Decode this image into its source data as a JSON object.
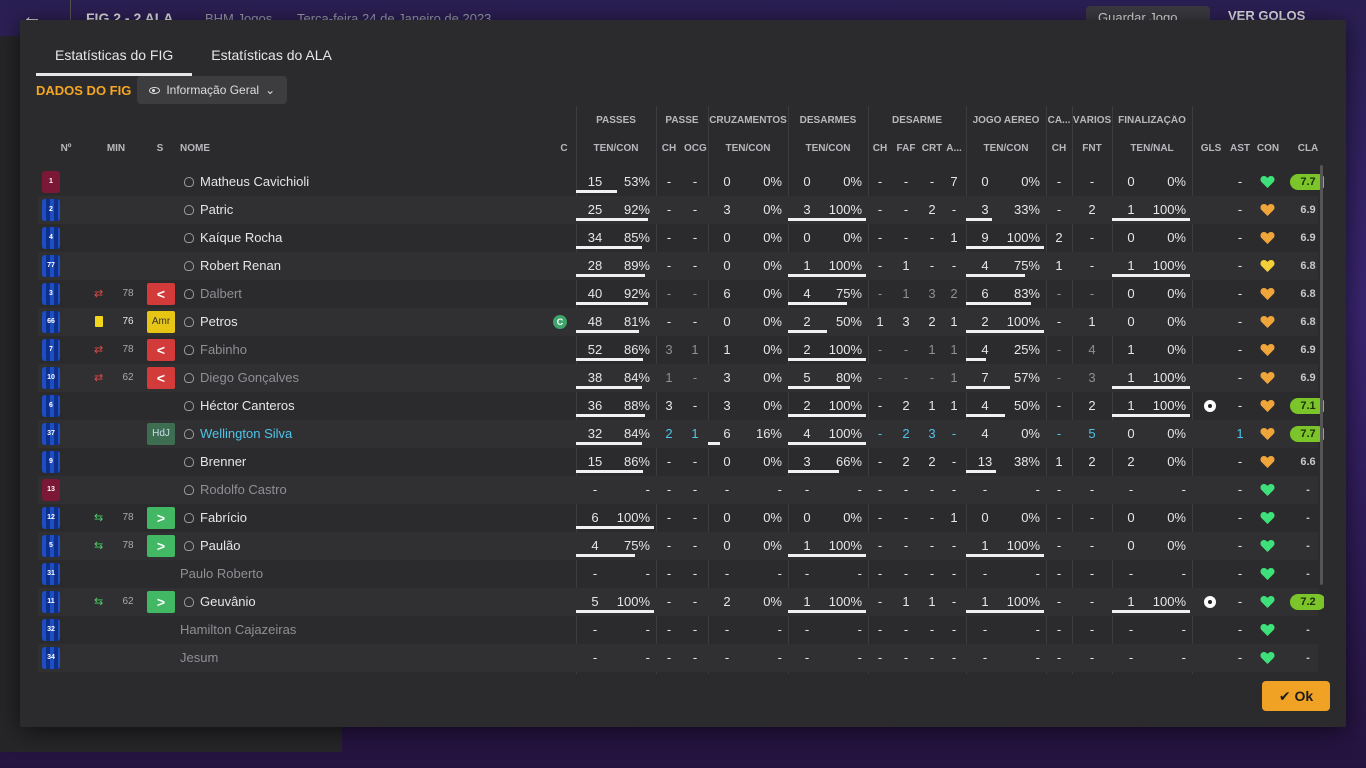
{
  "topbar": {
    "back_icon": "arrow-left-icon",
    "score": "FIG  2 - 2  ALA",
    "competition": "BHM Jogos",
    "date": "Terça-feira 24 de Janeiro de 2023",
    "save_label": "Guardar Jogo",
    "goals_label": "VER GOLOS"
  },
  "tabs": [
    "Estatísticas do FIG",
    "Estatísticas do ALA"
  ],
  "team_label": "DADOS DO FIG",
  "view_dropdown": "Informação Geral",
  "group_headers": [
    "PASSES",
    "PASSE",
    "CRUZAMENTOS",
    "DESARMES",
    "DESARME",
    "JOGO AÉREO",
    "CA...",
    "VÁRIOS",
    "FINALIZAÇÃO"
  ],
  "column_headers": {
    "num": "Nº",
    "min": "MIN",
    "s": "S",
    "name": "NOME",
    "c": "C",
    "passes": "TEN/CON",
    "passe_ch": "CH",
    "passe_ocg": "OCG",
    "cruz": "TEN/CON",
    "desarmes": "TEN/CON",
    "des_ch": "CH",
    "des_faf": "FAF",
    "des_crt": "CRT",
    "des_a": "A...",
    "aereo": "TEN/CON",
    "ca_ch": "CH",
    "var_fnt": "FNT",
    "fin": "TEN/NAL",
    "gls": "GLS",
    "ast": "AST",
    "con": "CON",
    "cla": "CLA"
  },
  "accent_color": "#f5a623",
  "rows": [
    {
      "num": "1",
      "gk": true,
      "sub": "",
      "min": "",
      "badge": "",
      "badge_text": "",
      "name": "Matheus Cavichioli",
      "style": "",
      "cap": false,
      "p1": "15",
      "p2": "53%",
      "pf": 0.53,
      "pch": "-",
      "ocg": "-",
      "c1": "0",
      "c2": "0%",
      "cf": 0,
      "d1": "0",
      "d2": "0%",
      "df": 0,
      "dch": "-",
      "faf": "-",
      "crt": "-",
      "da": "7",
      "a1": "0",
      "a2": "0%",
      "af": 0,
      "cach": "-",
      "fnt": "-",
      "f1": "0",
      "f2": "0%",
      "ff": 0,
      "ball": false,
      "ast": "-",
      "rating": "7.7",
      "hi": true,
      "heart": "green"
    },
    {
      "num": "2",
      "gk": false,
      "sub": "",
      "min": "",
      "badge": "",
      "badge_text": "",
      "name": "Patric",
      "style": "",
      "cap": false,
      "p1": "25",
      "p2": "92%",
      "pf": 0.92,
      "pch": "-",
      "ocg": "-",
      "c1": "3",
      "c2": "0%",
      "cf": 0,
      "d1": "3",
      "d2": "100%",
      "df": 1,
      "dch": "-",
      "faf": "-",
      "crt": "2",
      "da": "-",
      "a1": "3",
      "a2": "33%",
      "af": 0.33,
      "cach": "-",
      "fnt": "2",
      "f1": "1",
      "f2": "100%",
      "ff": 1,
      "ball": false,
      "ast": "-",
      "rating": "6.9",
      "hi": false,
      "heart": "orange"
    },
    {
      "num": "4",
      "gk": false,
      "sub": "",
      "min": "",
      "badge": "",
      "badge_text": "",
      "name": "Kaíque Rocha",
      "style": "",
      "cap": false,
      "p1": "34",
      "p2": "85%",
      "pf": 0.85,
      "pch": "-",
      "ocg": "-",
      "c1": "0",
      "c2": "0%",
      "cf": 0,
      "d1": "0",
      "d2": "0%",
      "df": 0,
      "dch": "-",
      "faf": "-",
      "crt": "-",
      "da": "1",
      "a1": "9",
      "a2": "100%",
      "af": 1,
      "cach": "2",
      "fnt": "-",
      "f1": "0",
      "f2": "0%",
      "ff": 0,
      "ball": false,
      "ast": "-",
      "rating": "6.9",
      "hi": false,
      "heart": "orange"
    },
    {
      "num": "77",
      "gk": false,
      "sub": "",
      "min": "",
      "badge": "",
      "badge_text": "",
      "name": "Robert Renan",
      "style": "",
      "cap": false,
      "p1": "28",
      "p2": "89%",
      "pf": 0.89,
      "pch": "-",
      "ocg": "-",
      "c1": "0",
      "c2": "0%",
      "cf": 0,
      "d1": "1",
      "d2": "100%",
      "df": 1,
      "dch": "-",
      "faf": "1",
      "crt": "-",
      "da": "-",
      "a1": "4",
      "a2": "75%",
      "af": 0.75,
      "cach": "1",
      "fnt": "-",
      "f1": "1",
      "f2": "100%",
      "ff": 1,
      "ball": false,
      "ast": "-",
      "rating": "6.8",
      "hi": false,
      "heart": "yellow"
    },
    {
      "num": "3",
      "gk": false,
      "sub": "out",
      "min": "78",
      "badge": "red",
      "badge_text": "<",
      "name": "Dalbert",
      "style": "dim",
      "cap": false,
      "p1": "40",
      "p2": "92%",
      "pf": 0.92,
      "pch": "-",
      "ocg": "-",
      "c1": "6",
      "c2": "0%",
      "cf": 0,
      "d1": "4",
      "d2": "75%",
      "df": 0.75,
      "dch": "-",
      "faf": "1",
      "crt": "3",
      "da": "2",
      "a1": "6",
      "a2": "83%",
      "af": 0.83,
      "cach": "-",
      "fnt": "-",
      "f1": "0",
      "f2": "0%",
      "ff": 0,
      "ball": false,
      "ast": "-",
      "rating": "6.8",
      "hi": false,
      "heart": "orange"
    },
    {
      "num": "66",
      "gk": false,
      "sub": "card",
      "min": "76",
      "badge": "yellow",
      "badge_text": "Amr",
      "name": "Petros",
      "style": "",
      "cap": true,
      "p1": "48",
      "p2": "81%",
      "pf": 0.81,
      "pch": "-",
      "ocg": "-",
      "c1": "0",
      "c2": "0%",
      "cf": 0,
      "d1": "2",
      "d2": "50%",
      "df": 0.5,
      "dch": "1",
      "faf": "3",
      "crt": "2",
      "da": "1",
      "a1": "2",
      "a2": "100%",
      "af": 1,
      "cach": "-",
      "fnt": "1",
      "f1": "0",
      "f2": "0%",
      "ff": 0,
      "ball": false,
      "ast": "-",
      "rating": "6.8",
      "hi": false,
      "heart": "orange"
    },
    {
      "num": "7",
      "gk": false,
      "sub": "out",
      "min": "78",
      "badge": "red",
      "badge_text": "<",
      "name": "Fabinho",
      "style": "dim",
      "cap": false,
      "p1": "52",
      "p2": "86%",
      "pf": 0.86,
      "pch": "3",
      "ocg": "1",
      "c1": "1",
      "c2": "0%",
      "cf": 0,
      "d1": "2",
      "d2": "100%",
      "df": 1,
      "dch": "-",
      "faf": "-",
      "crt": "1",
      "da": "1",
      "a1": "4",
      "a2": "25%",
      "af": 0.25,
      "cach": "-",
      "fnt": "4",
      "f1": "1",
      "f2": "0%",
      "ff": 0,
      "ball": false,
      "ast": "-",
      "rating": "6.9",
      "hi": false,
      "heart": "orange"
    },
    {
      "num": "10",
      "gk": false,
      "sub": "out",
      "min": "62",
      "badge": "red",
      "badge_text": "<",
      "name": "Diego Gonçalves",
      "style": "dim",
      "cap": false,
      "p1": "38",
      "p2": "84%",
      "pf": 0.84,
      "pch": "1",
      "ocg": "-",
      "c1": "3",
      "c2": "0%",
      "cf": 0,
      "d1": "5",
      "d2": "80%",
      "df": 0.8,
      "dch": "-",
      "faf": "-",
      "crt": "-",
      "da": "1",
      "a1": "7",
      "a2": "57%",
      "af": 0.57,
      "cach": "-",
      "fnt": "3",
      "f1": "1",
      "f2": "100%",
      "ff": 1,
      "ball": false,
      "ast": "-",
      "rating": "6.9",
      "hi": false,
      "heart": "orange"
    },
    {
      "num": "6",
      "gk": false,
      "sub": "",
      "min": "",
      "badge": "",
      "badge_text": "",
      "name": "Héctor Canteros",
      "style": "",
      "cap": false,
      "p1": "36",
      "p2": "88%",
      "pf": 0.88,
      "pch": "3",
      "ocg": "-",
      "c1": "3",
      "c2": "0%",
      "cf": 0,
      "d1": "2",
      "d2": "100%",
      "df": 1,
      "dch": "-",
      "faf": "2",
      "crt": "1",
      "da": "1",
      "a1": "4",
      "a2": "50%",
      "af": 0.5,
      "cach": "-",
      "fnt": "2",
      "f1": "1",
      "f2": "100%",
      "ff": 1,
      "ball": true,
      "ast": "-",
      "rating": "7.1",
      "hi": true,
      "heart": "orange"
    },
    {
      "num": "37",
      "gk": false,
      "sub": "",
      "min": "",
      "badge": "hdj",
      "badge_text": "HdJ",
      "name": "Wellington Silva",
      "style": "blue",
      "cap": false,
      "p1": "32",
      "p2": "84%",
      "pf": 0.84,
      "pch": "2",
      "ocg": "1",
      "c1": "6",
      "c2": "16%",
      "cf": 0.16,
      "d1": "4",
      "d2": "100%",
      "df": 1,
      "dch": "-",
      "faf": "2",
      "crt": "3",
      "da": "-",
      "a1": "4",
      "a2": "0%",
      "af": 0,
      "cach": "-",
      "fnt": "5",
      "f1": "0",
      "f2": "0%",
      "ff": 0,
      "ball": false,
      "ast": "1",
      "rating": "7.7",
      "hi": true,
      "heart": "orange"
    },
    {
      "num": "9",
      "gk": false,
      "sub": "",
      "min": "",
      "badge": "",
      "badge_text": "",
      "name": "Brenner",
      "style": "",
      "cap": false,
      "p1": "15",
      "p2": "86%",
      "pf": 0.86,
      "pch": "-",
      "ocg": "-",
      "c1": "0",
      "c2": "0%",
      "cf": 0,
      "d1": "3",
      "d2": "66%",
      "df": 0.66,
      "dch": "-",
      "faf": "2",
      "crt": "2",
      "da": "-",
      "a1": "13",
      "a2": "38%",
      "af": 0.38,
      "cach": "1",
      "fnt": "2",
      "f1": "2",
      "f2": "0%",
      "ff": 0,
      "ball": false,
      "ast": "-",
      "rating": "6.6",
      "hi": false,
      "heart": "orange"
    },
    {
      "num": "13",
      "gk": true,
      "sub": "",
      "min": "",
      "badge": "",
      "badge_text": "",
      "name": "Rodolfo Castro",
      "style": "dim",
      "cap": false,
      "p1": "-",
      "p2": "-",
      "pf": -1,
      "pch": "-",
      "ocg": "-",
      "c1": "-",
      "c2": "-",
      "cf": -1,
      "d1": "-",
      "d2": "-",
      "df": -1,
      "dch": "-",
      "faf": "-",
      "crt": "-",
      "da": "-",
      "a1": "-",
      "a2": "-",
      "af": -1,
      "cach": "-",
      "fnt": "-",
      "f1": "-",
      "f2": "-",
      "ff": -1,
      "ball": false,
      "ast": "-",
      "rating": "-",
      "hi": false,
      "heart": "green"
    },
    {
      "num": "12",
      "gk": false,
      "sub": "in",
      "min": "78",
      "badge": "green",
      "badge_text": ">",
      "name": "Fabrício",
      "style": "",
      "cap": false,
      "p1": "6",
      "p2": "100%",
      "pf": 1,
      "pch": "-",
      "ocg": "-",
      "c1": "0",
      "c2": "0%",
      "cf": 0,
      "d1": "0",
      "d2": "0%",
      "df": 0,
      "dch": "-",
      "faf": "-",
      "crt": "-",
      "da": "1",
      "a1": "0",
      "a2": "0%",
      "af": 0,
      "cach": "-",
      "fnt": "-",
      "f1": "0",
      "f2": "0%",
      "ff": 0,
      "ball": false,
      "ast": "-",
      "rating": "-",
      "hi": false,
      "heart": "green"
    },
    {
      "num": "5",
      "gk": false,
      "sub": "in",
      "min": "78",
      "badge": "green",
      "badge_text": ">",
      "name": "Paulão",
      "style": "",
      "cap": false,
      "p1": "4",
      "p2": "75%",
      "pf": 0.75,
      "pch": "-",
      "ocg": "-",
      "c1": "0",
      "c2": "0%",
      "cf": 0,
      "d1": "1",
      "d2": "100%",
      "df": 1,
      "dch": "-",
      "faf": "-",
      "crt": "-",
      "da": "-",
      "a1": "1",
      "a2": "100%",
      "af": 1,
      "cach": "-",
      "fnt": "-",
      "f1": "0",
      "f2": "0%",
      "ff": 0,
      "ball": false,
      "ast": "-",
      "rating": "-",
      "hi": false,
      "heart": "green"
    },
    {
      "num": "31",
      "gk": false,
      "sub": "",
      "min": "",
      "badge": "",
      "badge_text": "",
      "name": "Paulo Roberto",
      "style": "dim nohead",
      "cap": false,
      "p1": "-",
      "p2": "-",
      "pf": -1,
      "pch": "-",
      "ocg": "-",
      "c1": "-",
      "c2": "-",
      "cf": -1,
      "d1": "-",
      "d2": "-",
      "df": -1,
      "dch": "-",
      "faf": "-",
      "crt": "-",
      "da": "-",
      "a1": "-",
      "a2": "-",
      "af": -1,
      "cach": "-",
      "fnt": "-",
      "f1": "-",
      "f2": "-",
      "ff": -1,
      "ball": false,
      "ast": "-",
      "rating": "-",
      "hi": false,
      "heart": "green"
    },
    {
      "num": "11",
      "gk": false,
      "sub": "in",
      "min": "62",
      "badge": "green",
      "badge_text": ">",
      "name": "Geuvânio",
      "style": "",
      "cap": false,
      "p1": "5",
      "p2": "100%",
      "pf": 1,
      "pch": "-",
      "ocg": "-",
      "c1": "2",
      "c2": "0%",
      "cf": 0,
      "d1": "1",
      "d2": "100%",
      "df": 1,
      "dch": "-",
      "faf": "1",
      "crt": "1",
      "da": "-",
      "a1": "1",
      "a2": "100%",
      "af": 1,
      "cach": "-",
      "fnt": "-",
      "f1": "1",
      "f2": "100%",
      "ff": 1,
      "ball": true,
      "ast": "-",
      "rating": "7.2",
      "hi": true,
      "heart": "green"
    },
    {
      "num": "32",
      "gk": false,
      "sub": "",
      "min": "",
      "badge": "",
      "badge_text": "",
      "name": "Hamilton Cajazeiras",
      "style": "dim nohead",
      "cap": false,
      "p1": "-",
      "p2": "-",
      "pf": -1,
      "pch": "-",
      "ocg": "-",
      "c1": "-",
      "c2": "-",
      "cf": -1,
      "d1": "-",
      "d2": "-",
      "df": -1,
      "dch": "-",
      "faf": "-",
      "crt": "-",
      "da": "-",
      "a1": "-",
      "a2": "-",
      "af": -1,
      "cach": "-",
      "fnt": "-",
      "f1": "-",
      "f2": "-",
      "ff": -1,
      "ball": false,
      "ast": "-",
      "rating": "-",
      "hi": false,
      "heart": "green"
    },
    {
      "num": "34",
      "gk": false,
      "sub": "",
      "min": "",
      "badge": "",
      "badge_text": "",
      "name": "Jesum",
      "style": "dim nohead",
      "cap": false,
      "p1": "-",
      "p2": "-",
      "pf": -1,
      "pch": "-",
      "ocg": "-",
      "c1": "-",
      "c2": "-",
      "cf": -1,
      "d1": "-",
      "d2": "-",
      "df": -1,
      "dch": "-",
      "faf": "-",
      "crt": "-",
      "da": "-",
      "a1": "-",
      "a2": "-",
      "af": -1,
      "cach": "-",
      "fnt": "-",
      "f1": "-",
      "f2": "-",
      "ff": -1,
      "ball": false,
      "ast": "-",
      "rating": "-",
      "hi": false,
      "heart": "green"
    }
  ],
  "ok_label": "Ok"
}
